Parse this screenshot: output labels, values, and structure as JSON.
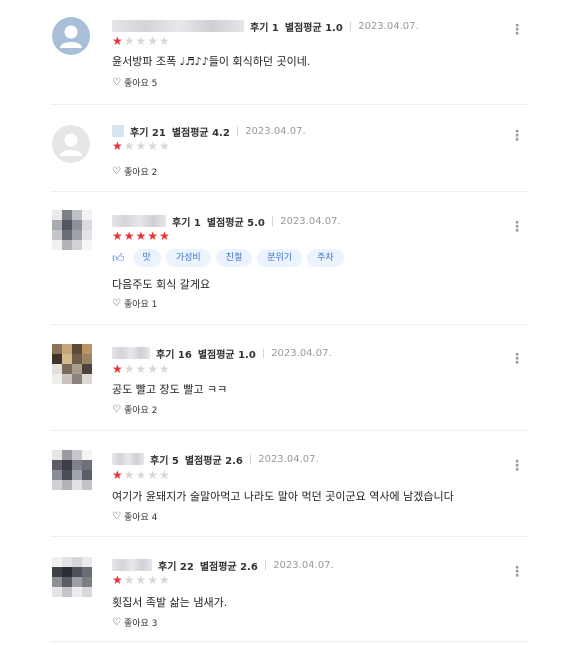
{
  "reviews": [
    {
      "review_count": "후기 1",
      "rating_avg": "별점평균 1.0",
      "date": "2023.04.07.",
      "stars": 1,
      "text": "윤서방파 조폭 ♩♬♪♪들이 회식하던 곳이네.",
      "likes": "좋아요 5",
      "avatar": "default-blue"
    },
    {
      "review_count": "후기 21",
      "rating_avg": "별점평균 4.2",
      "date": "2023.04.07.",
      "stars": 1,
      "text": "",
      "likes": "좋아요 2",
      "avatar": "default-gray"
    },
    {
      "review_count": "후기 1",
      "rating_avg": "별점평균 5.0",
      "date": "2023.04.07.",
      "stars": 5,
      "tags": [
        "맛",
        "가성비",
        "친절",
        "분위기",
        "주차"
      ],
      "text": "다음주도 회식 갈게요",
      "likes": "좋아요 1",
      "avatar": "mosaic"
    },
    {
      "review_count": "후기 16",
      "rating_avg": "별점평균 1.0",
      "date": "2023.04.07.",
      "stars": 1,
      "text": "공도 빨고 장도 빨고 ㅋㅋ",
      "likes": "좋아요 2",
      "avatar": "mosaic"
    },
    {
      "review_count": "후기 5",
      "rating_avg": "별점평균 2.6",
      "date": "2023.04.07.",
      "stars": 1,
      "text": "여기가 윤돼지가 술말아먹고 나라도 말아 먹던 곳이군요 역사에 남겠습니다",
      "likes": "좋아요 4",
      "avatar": "mosaic"
    },
    {
      "review_count": "후기 22",
      "rating_avg": "별점평균 2.6",
      "date": "2023.04.07.",
      "stars": 1,
      "text": "횟집서 족발 삶는 냄새가.",
      "likes": "좋아요 3",
      "avatar": "mosaic"
    }
  ],
  "icons": {
    "more": "more-vertical-icon",
    "like": "heart-outline-icon",
    "thumb": "thumbs-up-icon",
    "star": "star-icon"
  },
  "colors": {
    "star_on": "#e8323c",
    "star_off": "#d8d8d8",
    "tag_bg": "#ebf3ff",
    "tag_text": "#3e72c8"
  }
}
